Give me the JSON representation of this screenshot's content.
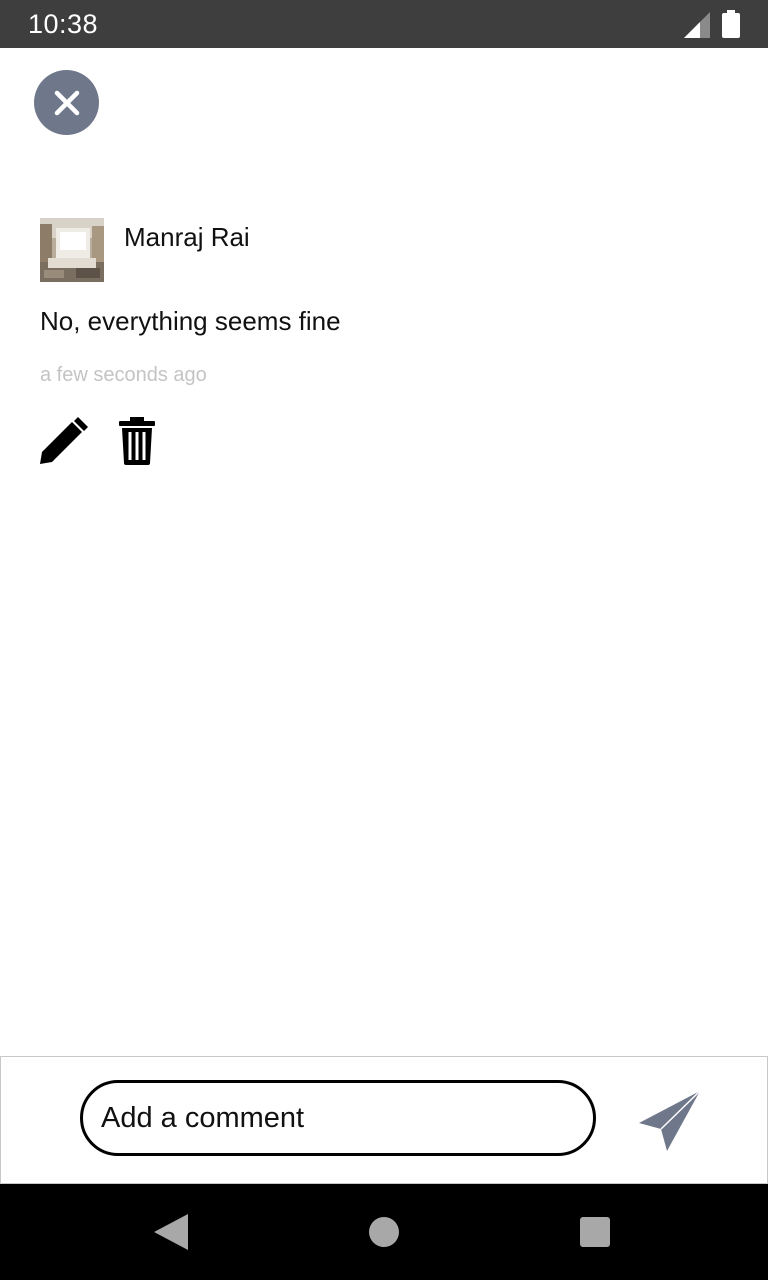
{
  "status_bar": {
    "time": "10:38",
    "signal_icon": "cellular-signal-icon",
    "battery_icon": "battery-full-icon"
  },
  "close_icon": "close-icon",
  "comment": {
    "author": "Manraj Rai",
    "avatar": "user-avatar-room-photo",
    "text": "No, everything seems fine",
    "time": "a few seconds ago",
    "actions": {
      "edit_icon": "pencil-icon",
      "delete_icon": "trash-icon"
    }
  },
  "composer": {
    "placeholder": "Add a comment",
    "send_icon": "send-icon"
  },
  "colors": {
    "accent": "#6f778b",
    "status_bar": "#3e3e3e",
    "timestamp": "#c4c4c4",
    "nav_bar": "#000000"
  }
}
